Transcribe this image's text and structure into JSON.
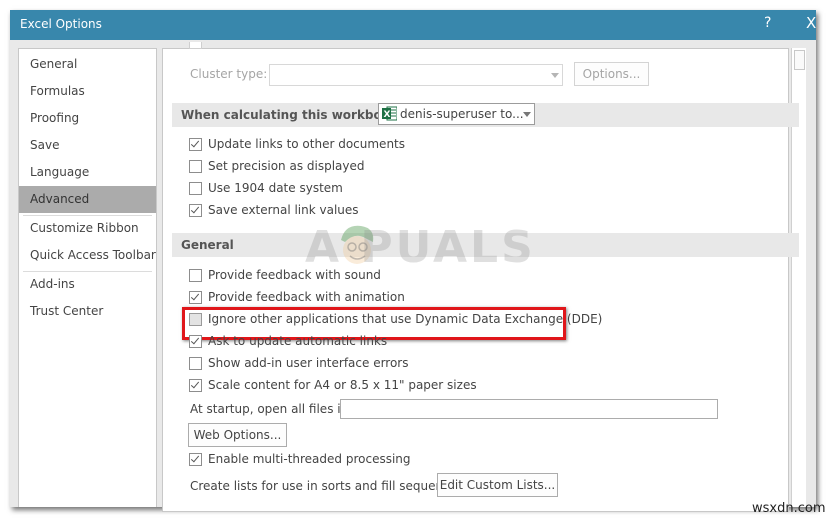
{
  "window": {
    "title": "Excel Options",
    "help_label": "?",
    "close_label": "X"
  },
  "sidebar": {
    "items": [
      {
        "label": "General",
        "active": false
      },
      {
        "label": "Formulas",
        "active": false
      },
      {
        "label": "Proofing",
        "active": false
      },
      {
        "label": "Save",
        "active": false
      },
      {
        "label": "Language",
        "active": false
      },
      {
        "label": "Advanced",
        "active": true
      },
      {
        "label": "Customize Ribbon",
        "active": false
      },
      {
        "label": "Quick Access Toolbar",
        "active": false
      },
      {
        "label": "Add-ins",
        "active": false
      },
      {
        "label": "Trust Center",
        "active": false
      }
    ]
  },
  "cluster": {
    "label": "Cluster type:",
    "value": "",
    "options_button": "Options..."
  },
  "calc_section": {
    "title": "When calculating this workbook:",
    "workbook_select": "denis-superuser to...",
    "workbook_icon": "excel-icon",
    "options": [
      {
        "label": "Update links to other documents",
        "checked": true
      },
      {
        "label": "Set precision as displayed",
        "checked": false
      },
      {
        "label": "Use 1904 date system",
        "checked": false
      },
      {
        "label": "Save external link values",
        "checked": true
      }
    ]
  },
  "general_section": {
    "title": "General",
    "options": [
      {
        "label": "Provide feedback with sound",
        "checked": false
      },
      {
        "label": "Provide feedback with animation",
        "checked": true
      },
      {
        "label": "Ignore other applications that use Dynamic Data Exchange (DDE)",
        "checked": false,
        "highlighted": true
      },
      {
        "label": "Ask to update automatic links",
        "checked": true
      },
      {
        "label": "Show add-in user interface errors",
        "checked": false
      },
      {
        "label": "Scale content for A4 or 8.5 x 11\" paper sizes",
        "checked": true
      }
    ],
    "startup_label": "At startup, open all files in:",
    "startup_value": "",
    "web_options_button": "Web Options...",
    "multithread": {
      "label": "Enable multi-threaded processing",
      "checked": true
    },
    "custom_lists_label": "Create lists for use in sorts and fill sequences:",
    "custom_lists_button": "Edit Custom Lists..."
  },
  "watermarks": {
    "appuals": "A  PUALS",
    "site": "wsxdn.com"
  },
  "colors": {
    "titlebar": "#3887ac",
    "active_nav": "#ababab",
    "highlight_box": "#e0161a",
    "excel_green": "#1e7145"
  }
}
